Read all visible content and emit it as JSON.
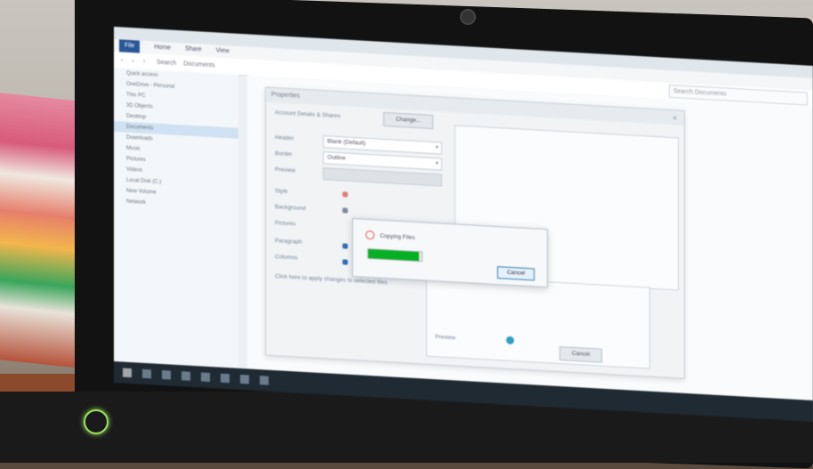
{
  "window": {
    "title": "Properties",
    "ribbon_tabs": [
      "File",
      "Home",
      "Share",
      "View"
    ],
    "address": "Search",
    "address_path": "Documents",
    "search_placeholder": "Search Documents"
  },
  "sidebar": {
    "items": [
      {
        "label": "Quick access",
        "selected": false
      },
      {
        "label": "OneDrive - Personal",
        "selected": false
      },
      {
        "label": "This PC",
        "selected": false
      },
      {
        "label": "3D Objects",
        "selected": false
      },
      {
        "label": "Desktop",
        "selected": false
      },
      {
        "label": "Documents",
        "selected": true
      },
      {
        "label": "Downloads",
        "selected": false
      },
      {
        "label": "Music",
        "selected": false
      },
      {
        "label": "Pictures",
        "selected": false
      },
      {
        "label": "Videos",
        "selected": false
      },
      {
        "label": "Local Disk (C:)",
        "selected": false
      },
      {
        "label": "New Volume",
        "selected": false
      },
      {
        "label": "Network",
        "selected": false
      }
    ]
  },
  "dialog": {
    "title": "Properties",
    "rows": [
      {
        "label": "Account Details & Shares",
        "button": "Change..."
      },
      {
        "label": "Header",
        "value": "Blank (Default)"
      },
      {
        "label": "Border",
        "value": "Outline"
      },
      {
        "label": "Preview",
        "value": ""
      }
    ],
    "options": [
      "Style",
      "Background",
      "Pictures",
      "Paragraph",
      "Columns"
    ],
    "note": "Click here to apply changes to selected files",
    "bottom_buttons": [
      "Preview",
      "Cancel"
    ],
    "close_glyph": "×"
  },
  "popup": {
    "status": "Copying Files",
    "progress": 0.95,
    "cancel_label": "Cancel",
    "progress_color": "#06b025"
  },
  "taskbar": {
    "icons": [
      "start-icon",
      "search-icon",
      "task-view-icon",
      "edge-icon",
      "explorer-icon",
      "store-icon",
      "mail-icon",
      "settings-icon"
    ]
  }
}
